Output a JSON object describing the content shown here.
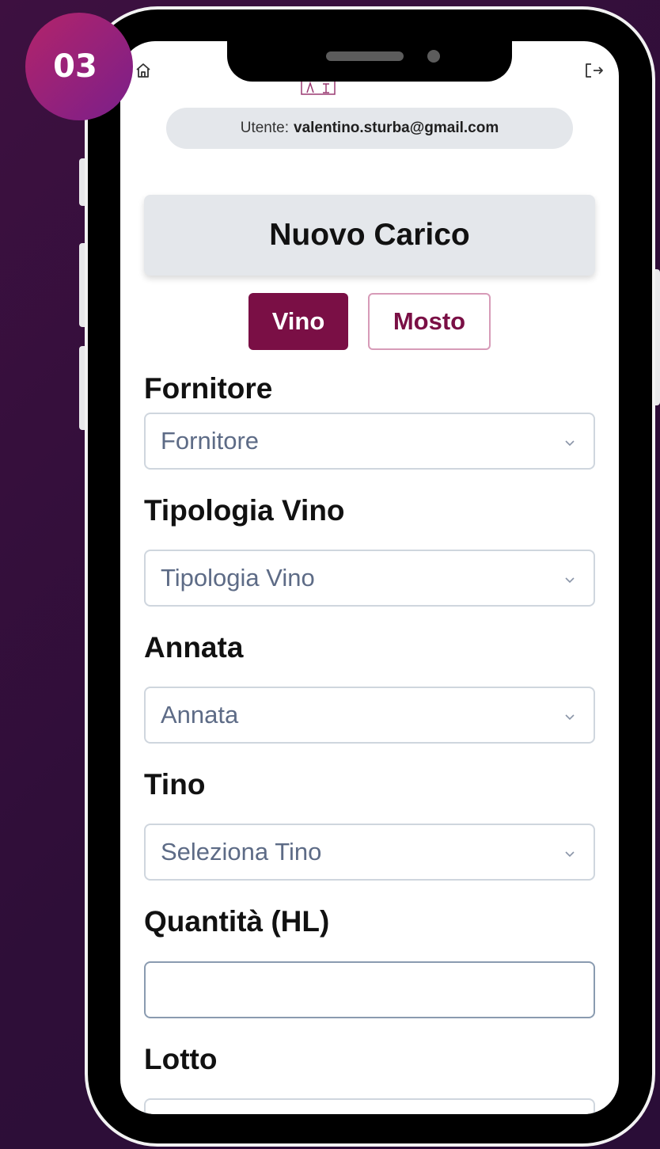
{
  "step_badge": "03",
  "header": {
    "home_icon": "home-icon",
    "logout_icon": "logout-icon",
    "logo": "winery-logo"
  },
  "user": {
    "prefix": "Utente:",
    "email": "valentino.sturba@gmail.com"
  },
  "page_title": "Nuovo Carico",
  "toggle": {
    "options": [
      "Vino",
      "Mosto"
    ],
    "selected": "Vino"
  },
  "form": {
    "fornitore": {
      "label": "Fornitore",
      "placeholder": "Fornitore"
    },
    "tipologia": {
      "label": "Tipologia Vino",
      "placeholder": "Tipologia Vino"
    },
    "annata": {
      "label": "Annata",
      "placeholder": "Annata"
    },
    "tino": {
      "label": "Tino",
      "placeholder": "Seleziona Tino"
    },
    "quantita": {
      "label": "Quantità (HL)",
      "value": ""
    },
    "lotto": {
      "label": "Lotto",
      "value": ""
    }
  },
  "colors": {
    "accent": "#7a0f45",
    "background": "#2e0e38",
    "badge": "#a3246f"
  }
}
